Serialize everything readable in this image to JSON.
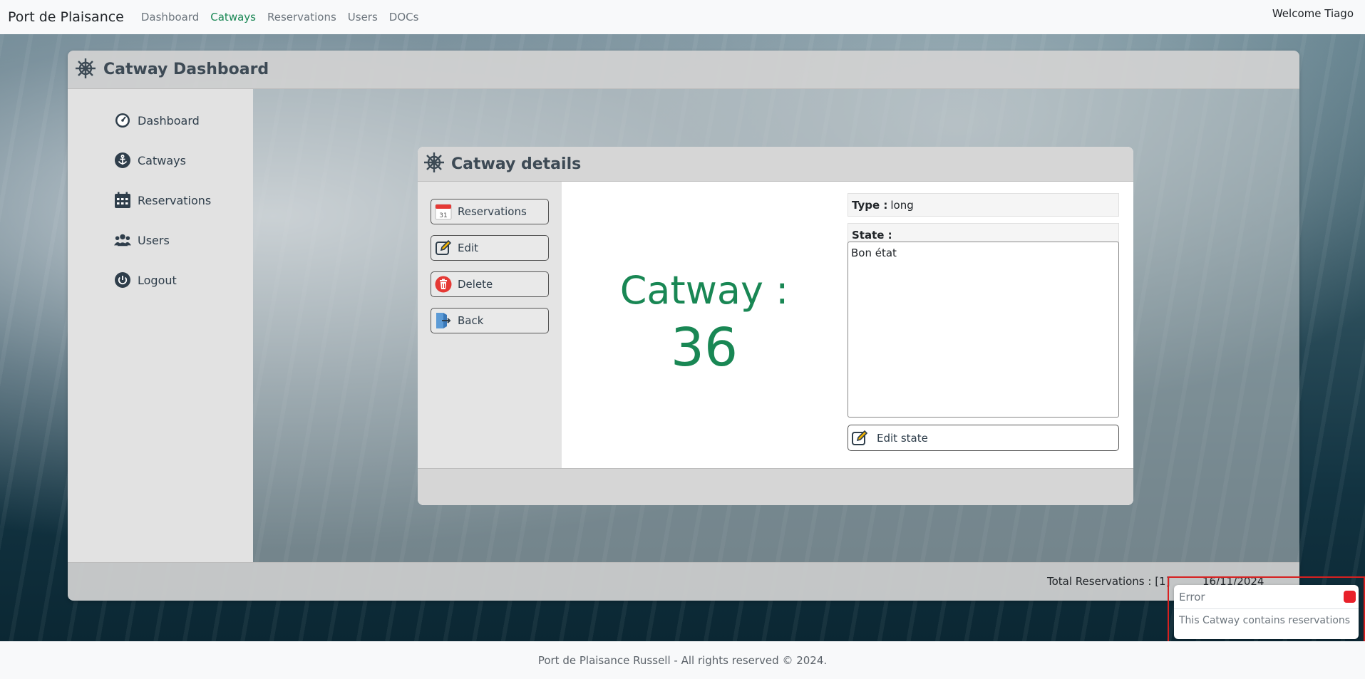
{
  "navbar": {
    "brand": "Port de Plaisance",
    "links": [
      {
        "label": "Dashboard",
        "active": false
      },
      {
        "label": "Catways",
        "active": true
      },
      {
        "label": "Reservations",
        "active": false
      },
      {
        "label": "Users",
        "active": false
      },
      {
        "label": "DOCs",
        "active": false
      }
    ],
    "welcome": "Welcome Tiago"
  },
  "dashboard": {
    "title": "Catway Dashboard",
    "title_icon": "ship-wheel-icon",
    "sidebar": [
      {
        "label": "Dashboard",
        "icon": "dashboard-gauge-icon"
      },
      {
        "label": "Catways",
        "icon": "anchor-icon"
      },
      {
        "label": "Reservations",
        "icon": "calendar-icon"
      },
      {
        "label": "Users",
        "icon": "users-icon"
      },
      {
        "label": "Logout",
        "icon": "power-icon"
      }
    ],
    "footer": {
      "total_reservations": "Total Reservations : [1]",
      "date": "16/11/2024"
    }
  },
  "details": {
    "title": "Catway details",
    "title_icon": "ship-wheel-icon",
    "actions": [
      {
        "label": "Reservations",
        "icon": "calendar-31-icon"
      },
      {
        "label": "Edit",
        "icon": "edit-icon"
      },
      {
        "label": "Delete",
        "icon": "trash-icon"
      },
      {
        "label": "Back",
        "icon": "exit-icon"
      }
    ],
    "catway_label": "Catway :",
    "catway_number": "36",
    "type_label": "Type :",
    "type_value": "long",
    "state_label": "State :",
    "state_value": "Bon état",
    "edit_state_label": "Edit state"
  },
  "toast": {
    "title": "Error",
    "message": "This Catway contains reservations"
  },
  "page_footer": "Port de Plaisance Russell - All rights reserved © 2024.",
  "colors": {
    "accent_green": "#198754",
    "error_red": "#e8202a",
    "highlight_outline": "#d62020"
  }
}
